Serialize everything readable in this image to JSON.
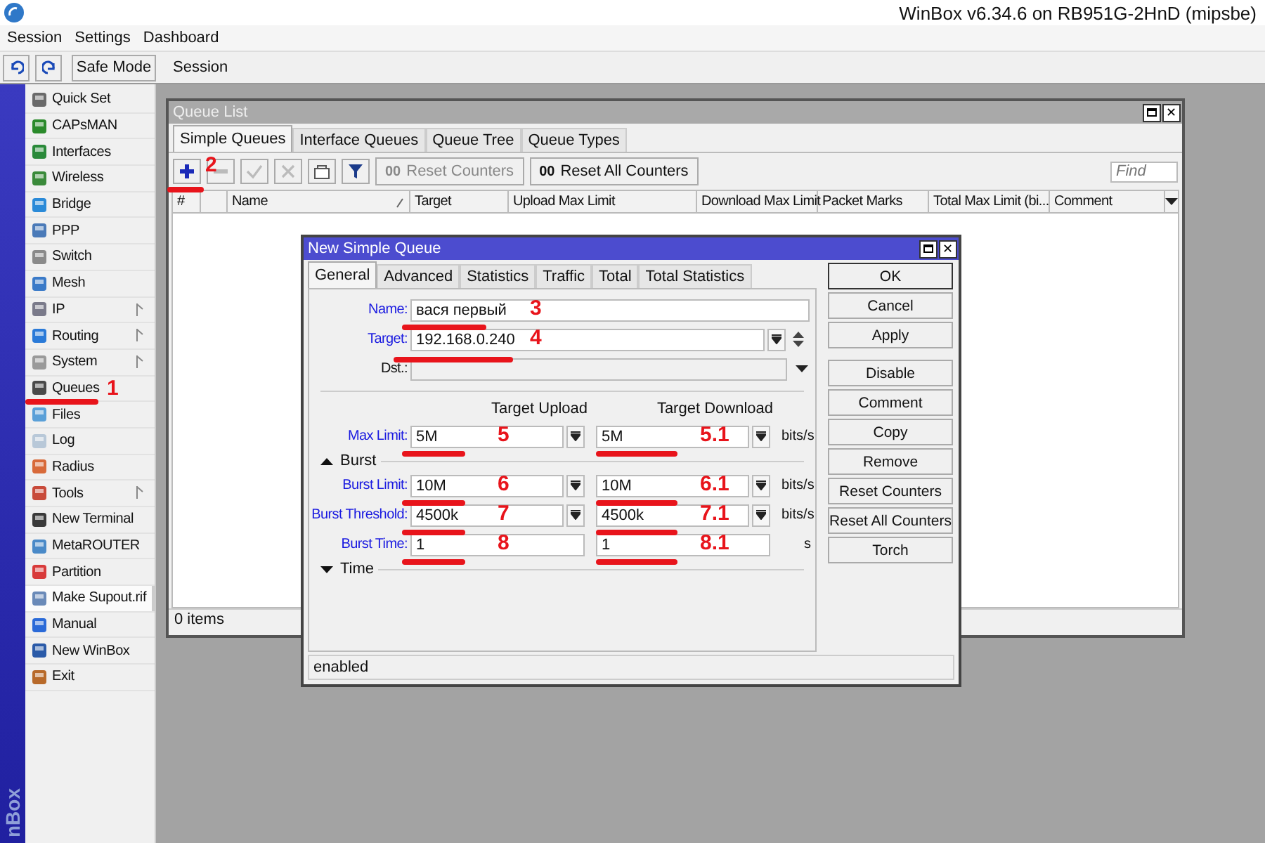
{
  "window": {
    "title": "WinBox v6.34.6 on RB951G-2HnD (mipsbe)"
  },
  "menu": [
    "Session",
    "Settings",
    "Dashboard"
  ],
  "toolbar": {
    "safe_mode": "Safe Mode",
    "session_label": "Session"
  },
  "side_label": "nBox",
  "sidebar": {
    "items": [
      {
        "label": "Quick Set",
        "submenu": false,
        "highlighted": false
      },
      {
        "label": "CAPsMAN",
        "submenu": false,
        "highlighted": false
      },
      {
        "label": "Interfaces",
        "submenu": false,
        "highlighted": false
      },
      {
        "label": "Wireless",
        "submenu": false,
        "highlighted": false
      },
      {
        "label": "Bridge",
        "submenu": false,
        "highlighted": false
      },
      {
        "label": "PPP",
        "submenu": false,
        "highlighted": false
      },
      {
        "label": "Switch",
        "submenu": false,
        "highlighted": false
      },
      {
        "label": "Mesh",
        "submenu": false,
        "highlighted": false
      },
      {
        "label": "IP",
        "submenu": true,
        "highlighted": false
      },
      {
        "label": "Routing",
        "submenu": true,
        "highlighted": false
      },
      {
        "label": "System",
        "submenu": true,
        "highlighted": false
      },
      {
        "label": "Queues",
        "submenu": false,
        "highlighted": false,
        "marker": "1"
      },
      {
        "label": "Files",
        "submenu": false,
        "highlighted": false
      },
      {
        "label": "Log",
        "submenu": false,
        "highlighted": false
      },
      {
        "label": "Radius",
        "submenu": false,
        "highlighted": false
      },
      {
        "label": "Tools",
        "submenu": true,
        "highlighted": false
      },
      {
        "label": "New Terminal",
        "submenu": false,
        "highlighted": false
      },
      {
        "label": "MetaROUTER",
        "submenu": false,
        "highlighted": false
      },
      {
        "label": "Partition",
        "submenu": false,
        "highlighted": false
      },
      {
        "label": "Make Supout.rif",
        "submenu": false,
        "highlighted": true
      },
      {
        "label": "Manual",
        "submenu": false,
        "highlighted": false
      },
      {
        "label": "New WinBox",
        "submenu": false,
        "highlighted": false
      },
      {
        "label": "Exit",
        "submenu": false,
        "highlighted": false
      }
    ]
  },
  "queue_list": {
    "title": "Queue List",
    "close": "✕",
    "tabs": [
      {
        "label": "Simple Queues",
        "selected": true
      },
      {
        "label": "Interface Queues",
        "selected": false
      },
      {
        "label": "Queue Tree",
        "selected": false
      },
      {
        "label": "Queue Types",
        "selected": false
      }
    ],
    "tools": [
      {
        "kind": "add",
        "disabled": false,
        "marker": "2"
      },
      {
        "kind": "remove",
        "disabled": true
      },
      {
        "kind": "enable",
        "disabled": true
      },
      {
        "kind": "disable",
        "disabled": true
      },
      {
        "kind": "comment",
        "disabled": false
      },
      {
        "kind": "filter",
        "disabled": false
      },
      {
        "kind": "text",
        "glyph": "00",
        "label": "Reset Counters",
        "disabled": true
      },
      {
        "kind": "text",
        "glyph": "00",
        "label": "Reset All Counters",
        "disabled": false
      }
    ],
    "find": {
      "placeholder": "Find"
    },
    "columns": [
      "#",
      "Name",
      "Target",
      "Upload Max Limit",
      "Download Max Limit",
      "Packet Marks",
      "Total Max Limit (bi...",
      "Comment"
    ],
    "status": "0 items"
  },
  "dialog": {
    "title": "New Simple Queue",
    "close": "✕",
    "tabs": [
      {
        "label": "General",
        "selected": true
      },
      {
        "label": "Advanced",
        "selected": false
      },
      {
        "label": "Statistics",
        "selected": false
      },
      {
        "label": "Traffic",
        "selected": false
      },
      {
        "label": "Total",
        "selected": false
      },
      {
        "label": "Total Statistics",
        "selected": false
      }
    ],
    "fields": [
      {
        "kind": "text",
        "label": "Name:",
        "linked": true,
        "value": "вася первый",
        "marker": "3"
      },
      {
        "kind": "target",
        "label": "Target:",
        "linked": true,
        "value": "192.168.0.240",
        "marker": "4"
      },
      {
        "kind": "dst",
        "label": "Dst.:",
        "linked": false
      }
    ],
    "column_headers": [
      "Target Upload",
      "Target Download"
    ],
    "rows": [
      {
        "label": "Max Limit:",
        "upload": "5M",
        "download": "5M",
        "unit": "bits/s",
        "dropdown": true,
        "marker_upload": "5",
        "marker_download": "5.1"
      }
    ],
    "sections": [
      {
        "title": "Burst",
        "expanded": true,
        "rows": [
          {
            "label": "Burst Limit:",
            "upload": "10M",
            "download": "10M",
            "unit": "bits/s",
            "dropdown": true,
            "marker_upload": "6",
            "marker_download": "6.1"
          },
          {
            "label": "Burst Threshold:",
            "upload": "4500k",
            "download": "4500k",
            "unit": "bits/s",
            "dropdown": true,
            "marker_upload": "7",
            "marker_download": "7.1"
          },
          {
            "label": "Burst Time:",
            "upload": "1",
            "download": "1",
            "unit": "s",
            "dropdown": false,
            "marker_upload": "8",
            "marker_download": "8.1"
          }
        ]
      },
      {
        "title": "Time",
        "expanded": false
      }
    ],
    "buttons": [
      "OK",
      "Cancel",
      "Apply",
      "Disable",
      "Comment",
      "Copy",
      "Remove",
      "Reset Counters",
      "Reset All Counters",
      "Torch"
    ],
    "status": "enabled"
  }
}
